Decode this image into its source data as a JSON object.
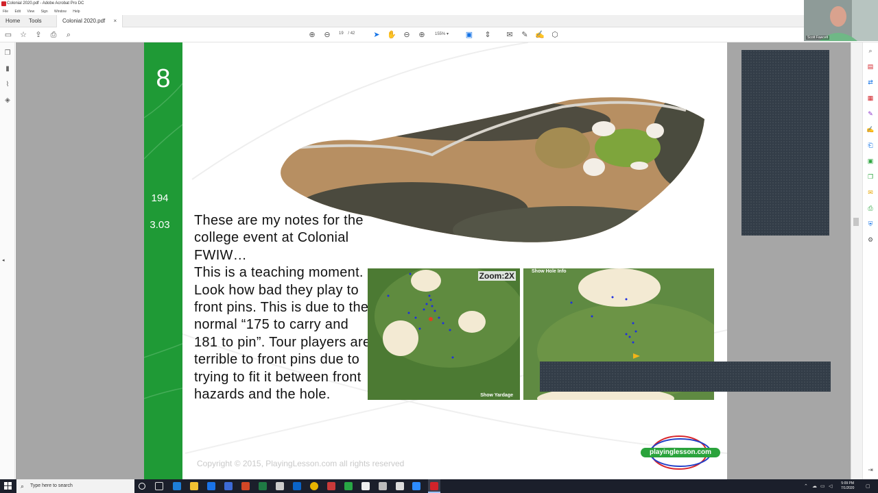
{
  "window": {
    "title": "Colonial 2020.pdf - Adobe Acrobat Pro DC"
  },
  "menu": [
    "File",
    "Edit",
    "View",
    "Sign",
    "Window",
    "Help"
  ],
  "tabs": {
    "home": "Home",
    "tools": "Tools",
    "document": "Colonial 2020.pdf",
    "close": "×"
  },
  "toolbar": {
    "page_current": "19",
    "page_total": "/ 42",
    "zoom": "155%"
  },
  "slide": {
    "hole_number": "8",
    "yardage": "194",
    "scoring_avg": "3.03",
    "notes": "These are my notes for the college event at Colonial FWIW…\nThis is a teaching moment.  Look how bad they play to front pins.  This is due to the normal “175 to carry and 181 to pin”.  Tour players are terrible to front pins due to trying to fit it between front hazards and the hole.",
    "inset_left": {
      "zoom_label": "Zoom:2X",
      "bottom_label": "Show Yardage"
    },
    "inset_right": {
      "top_label": "Show Hole Info"
    },
    "copyright": "Copyright © 2015, PlayingLesson.com all rights reserved",
    "logo_text": "playinglesson.com"
  },
  "webcam": {
    "name": "Scott Fawcett"
  },
  "taskbar": {
    "search_placeholder": "Type here to search",
    "time": "5:09 PM",
    "date": "7/1/2020"
  },
  "colors": {
    "green_bar": "#1f9a36",
    "acrobat_red": "#d2232a",
    "redaction": "#333d48",
    "taskbar": "#1b1f2b"
  }
}
